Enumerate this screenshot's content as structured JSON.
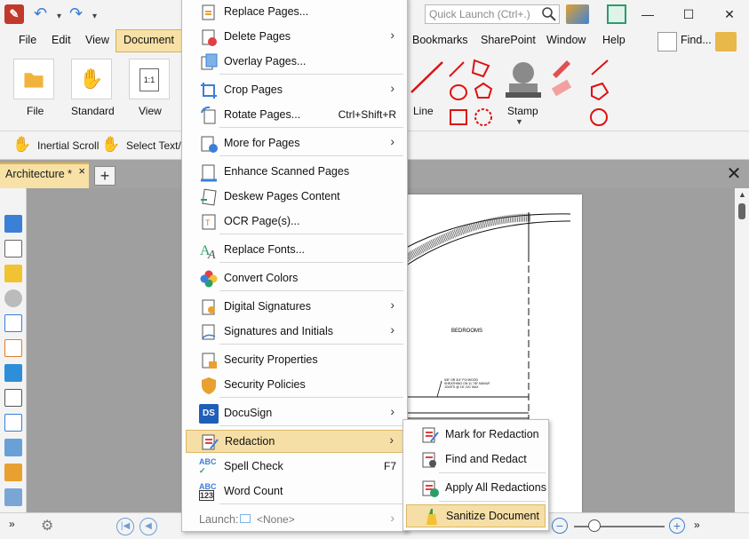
{
  "titlebar": {
    "quick_launch_placeholder": "Quick Launch (Ctrl+.)",
    "minimize": "—",
    "maximize": "☐",
    "close": "✕"
  },
  "menubar": {
    "items": [
      "File",
      "Edit",
      "View",
      "Document"
    ],
    "right_items": [
      "Bookmarks",
      "SharePoint",
      "Window",
      "Help"
    ],
    "find_label": "Find..."
  },
  "ribbon": {
    "file_label": "File",
    "standard_label": "Standard",
    "view_label": "View",
    "line_label": "Line",
    "stamp_label": "Stamp"
  },
  "toolbar2": {
    "inertial_scroll": "Inertial Scroll",
    "select_text": "Select Text/"
  },
  "tabs": {
    "doc_tab": "Architecture *",
    "close": "×",
    "plus": "+"
  },
  "drawing": {
    "room_label": "BEDROOMS",
    "note_line1": "5/8\" OR 3/4\" PLYWOOD",
    "note_line2": "SHEATHING ON 11 7/8\" MANUF.",
    "note_line3": "JOISTS @ 16\" O/C MAX"
  },
  "document_menu": {
    "items": [
      {
        "label": "Replace Pages...",
        "shortcut": "",
        "arrow": ""
      },
      {
        "label": "Delete Pages",
        "shortcut": "",
        "arrow": "›"
      },
      {
        "label": "Overlay Pages...",
        "shortcut": "",
        "arrow": ""
      },
      {
        "label": "Crop Pages",
        "shortcut": "",
        "arrow": "›"
      },
      {
        "label": "Rotate Pages...",
        "shortcut": "Ctrl+Shift+R",
        "arrow": ""
      },
      {
        "label": "More for Pages",
        "shortcut": "",
        "arrow": "›"
      },
      {
        "label": "Enhance Scanned Pages",
        "shortcut": "",
        "arrow": ""
      },
      {
        "label": "Deskew Pages Content",
        "shortcut": "",
        "arrow": ""
      },
      {
        "label": "OCR Page(s)...",
        "shortcut": "",
        "arrow": ""
      },
      {
        "label": "Replace Fonts...",
        "shortcut": "",
        "arrow": ""
      },
      {
        "label": "Convert Colors",
        "shortcut": "",
        "arrow": ""
      },
      {
        "label": "Digital Signatures",
        "shortcut": "",
        "arrow": "›"
      },
      {
        "label": "Signatures and Initials",
        "shortcut": "",
        "arrow": "›"
      },
      {
        "label": "Security Properties",
        "shortcut": "",
        "arrow": ""
      },
      {
        "label": "Security Policies",
        "shortcut": "",
        "arrow": ""
      },
      {
        "label": "DocuSign",
        "shortcut": "",
        "arrow": "›"
      },
      {
        "label": "Redaction",
        "shortcut": "",
        "arrow": "›"
      },
      {
        "label": "Spell Check",
        "shortcut": "F7",
        "arrow": ""
      },
      {
        "label": "Word Count",
        "shortcut": "",
        "arrow": ""
      },
      {
        "label": "Launch:",
        "shortcut": "",
        "arrow": "›"
      }
    ],
    "launch_value": "<None>"
  },
  "redaction_submenu": {
    "items": [
      "Mark for Redaction",
      "Find and Redact",
      "Apply All Redactions",
      "Sanitize Document"
    ]
  },
  "icon_labels": {
    "abc": "ABC",
    "n123": "123",
    "docusign": "DS"
  }
}
